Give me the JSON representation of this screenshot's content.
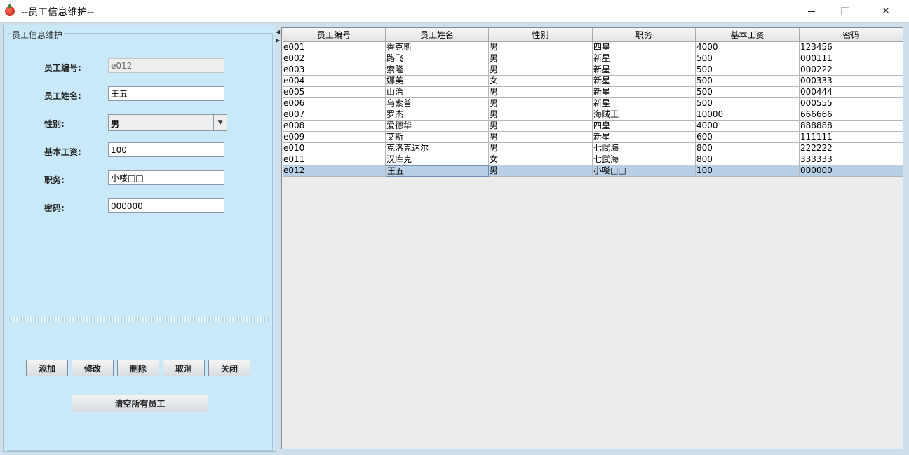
{
  "window": {
    "title": "--员工信息维护--",
    "icon": "tomato-app-icon"
  },
  "form": {
    "group_title": "员工信息维护",
    "id_label": "员工编号:",
    "id_value": "e012",
    "name_label": "员工姓名:",
    "name_value": "王五",
    "gender_label": "性别:",
    "gender_value": "男",
    "salary_label": "基本工资:",
    "salary_value": "100",
    "position_label": "职务:",
    "position_value": "小喽□□",
    "password_label": "密码:",
    "password_value": "000000"
  },
  "buttons": {
    "add": "添加",
    "modify": "修改",
    "delete": "删除",
    "cancel": "取消",
    "close": "关闭",
    "clear_all": "清空所有员工"
  },
  "table": {
    "columns": [
      "员工编号",
      "员工姓名",
      "性别",
      "职务",
      "基本工资",
      "密码"
    ],
    "rows": [
      [
        "e001",
        "香克斯",
        "男",
        "四皇",
        "4000",
        "123456"
      ],
      [
        "e002",
        "路飞",
        "男",
        "新星",
        "500",
        "000111"
      ],
      [
        "e003",
        "索隆",
        "男",
        "新星",
        "500",
        "000222"
      ],
      [
        "e004",
        "娜美",
        "女",
        "新星",
        "500",
        "000333"
      ],
      [
        "e005",
        "山治",
        "男",
        "新星",
        "500",
        "000444"
      ],
      [
        "e006",
        "乌索普",
        "男",
        "新星",
        "500",
        "000555"
      ],
      [
        "e007",
        "罗杰",
        "男",
        "海贼王",
        "10000",
        "666666"
      ],
      [
        "e008",
        "爱德华",
        "男",
        "四皇",
        "4000",
        "888888"
      ],
      [
        "e009",
        "艾斯",
        "男",
        "新星",
        "600",
        "111111"
      ],
      [
        "e010",
        "克洛克达尔",
        "男",
        "七武海",
        "800",
        "222222"
      ],
      [
        "e011",
        "汉库克",
        "女",
        "七武海",
        "800",
        "333333"
      ],
      [
        "e012",
        "王五",
        "男",
        "小喽□□",
        "100",
        "000000"
      ]
    ],
    "selected_row": 11
  },
  "colors": {
    "panel_bg": "#c9e9f8",
    "selection": "#b8cfe5"
  }
}
